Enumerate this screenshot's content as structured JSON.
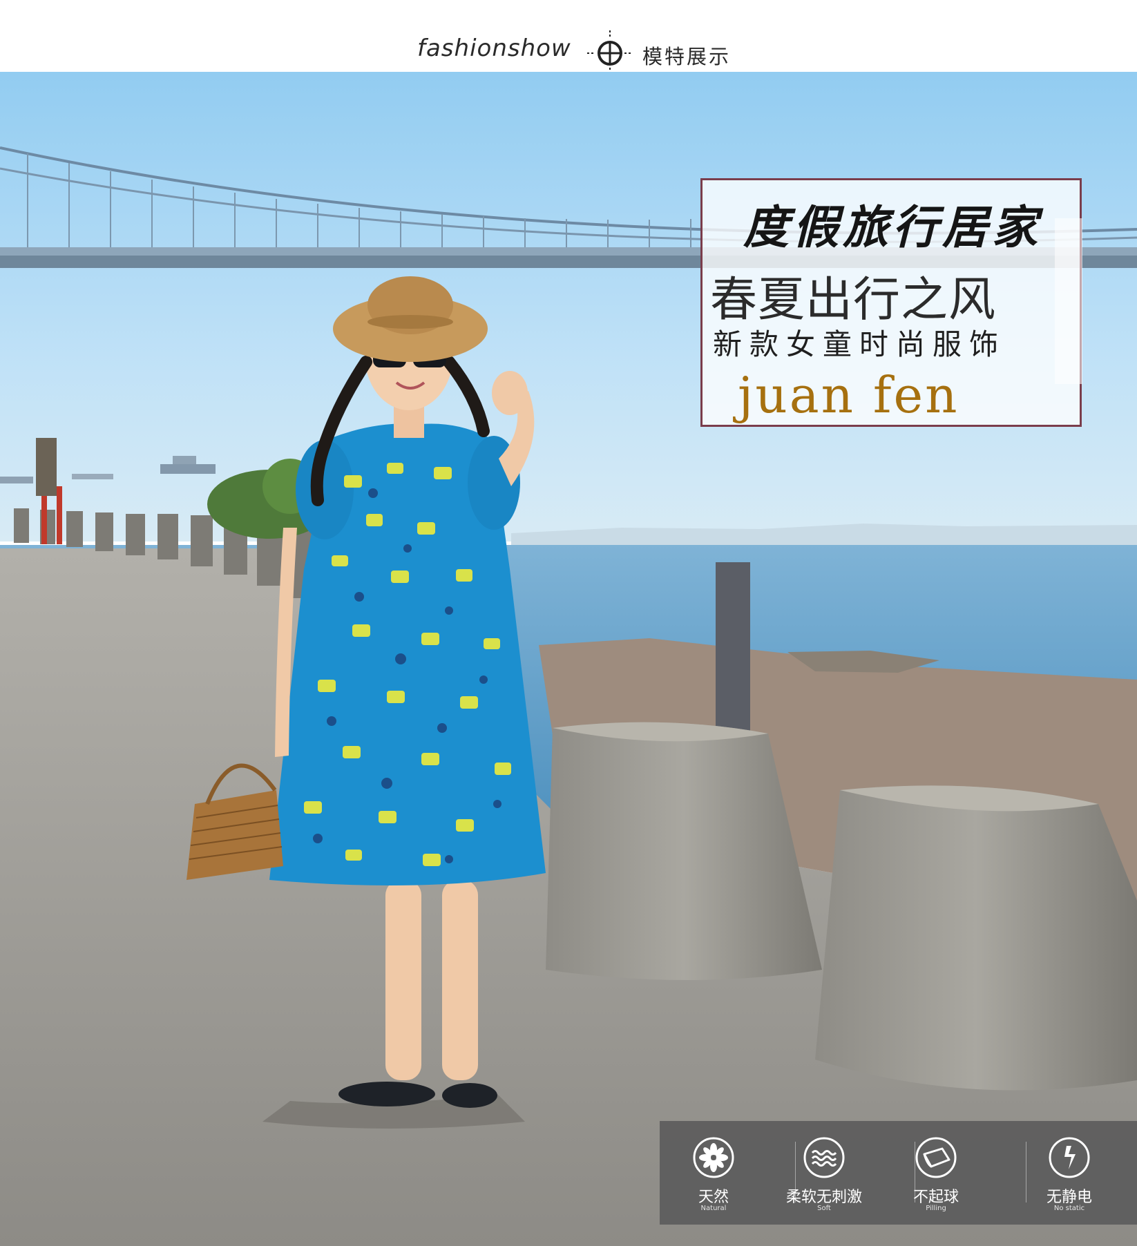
{
  "header": {
    "english": "fashionshow",
    "chinese": "模特展示"
  },
  "title_box": {
    "line1": "度假旅行居家",
    "line2": "春夏出行之风",
    "line3": "新款女童时尚服饰",
    "line4": "juan fen"
  },
  "features": [
    {
      "cn": "天然",
      "en": "Natural",
      "icon": "flower-icon"
    },
    {
      "cn": "柔软无刺激",
      "en": "Soft",
      "icon": "wave-icon"
    },
    {
      "cn": "不起球",
      "en": "Pilling",
      "icon": "fabric-icon"
    },
    {
      "cn": "无静电",
      "en": "No static",
      "icon": "lightning-icon"
    }
  ],
  "colors": {
    "title_border": "#7a3d4b",
    "brand_gold": "#a6700f",
    "dress_blue": "#1c8fcf",
    "sky": "#a9d6f3",
    "sea": "#5f9fc7",
    "feature_bar": "#5c5c5c"
  }
}
